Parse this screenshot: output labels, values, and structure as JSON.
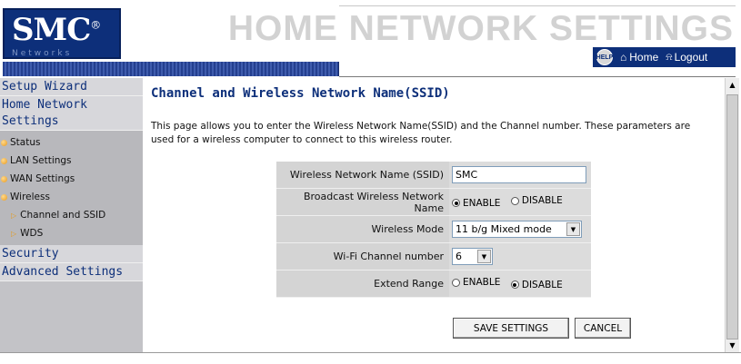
{
  "header": {
    "logo": "SMC",
    "logo_mark": "®",
    "logo_sub": "Networks",
    "banner": "HOME NETWORK SETTINGS",
    "help_label": "HELP",
    "home_label": "Home",
    "logout_label": "Logout"
  },
  "sidebar": {
    "setup_wizard": "Setup Wizard",
    "home_network": "Home Network Settings",
    "items": [
      {
        "label": "Status"
      },
      {
        "label": "LAN Settings"
      },
      {
        "label": "WAN Settings"
      },
      {
        "label": "Wireless"
      }
    ],
    "subitems": [
      {
        "label": "Channel and SSID"
      },
      {
        "label": "WDS"
      }
    ],
    "security": "Security",
    "advanced": "Advanced Settings"
  },
  "content": {
    "title": "Channel and Wireless Network Name(SSID)",
    "description": "This page allows you to enter the Wireless Network Name(SSID) and the Channel number. These parameters are used for a wireless computer to connect to this wireless router."
  },
  "form": {
    "ssid_label": "Wireless Network Name (SSID)",
    "ssid_value": "SMC",
    "broadcast_label": "Broadcast Wireless Network Name",
    "broadcast_enable": "ENABLE",
    "broadcast_disable": "DISABLE",
    "mode_label": "Wireless Mode",
    "mode_value": "11 b/g Mixed mode",
    "channel_label": "Wi-Fi Channel number",
    "channel_value": "6",
    "extend_label": "Extend Range",
    "extend_enable": "ENABLE",
    "extend_disable": "DISABLE"
  },
  "buttons": {
    "save": "SAVE SETTINGS",
    "cancel": "CANCEL"
  }
}
